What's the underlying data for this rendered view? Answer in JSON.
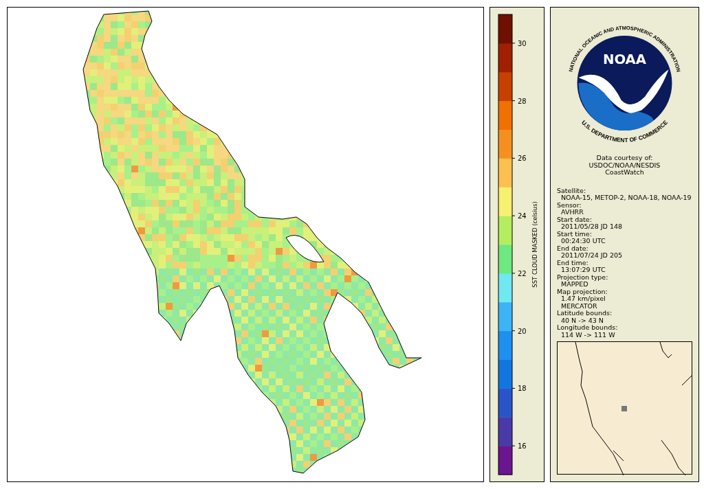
{
  "colorbar": {
    "label": "SST CLOUD MASKED (celsius)",
    "ticks": [
      "30",
      "28",
      "26",
      "24",
      "22",
      "20",
      "18",
      "16"
    ]
  },
  "logo": {
    "wordmark": "NOAA",
    "ring_top": "NATIONAL OCEANIC AND ATMOSPHERIC ADMINISTRATION",
    "ring_bottom": "U.S. DEPARTMENT OF COMMERCE"
  },
  "credits": [
    "Data courtesy of:",
    "USDOC/NOAA/NESDIS",
    "CoastWatch"
  ],
  "fields": [
    {
      "label": "Satellite:",
      "values": [
        "NOAA-15, METOP-2, NOAA-18, NOAA-19"
      ]
    },
    {
      "label": "Sensor:",
      "values": [
        "AVHRR"
      ]
    },
    {
      "label": "Start date:",
      "values": [
        "2011/05/28 JD 148"
      ]
    },
    {
      "label": "Start time:",
      "values": [
        "00:24:30 UTC"
      ]
    },
    {
      "label": "End date:",
      "values": [
        "2011/07/24 JD 205"
      ]
    },
    {
      "label": "End time:",
      "values": [
        "13:07:29 UTC"
      ]
    },
    {
      "label": "Projection type:",
      "values": [
        "MAPPED"
      ]
    },
    {
      "label": "Map projection:",
      "values": [
        "1.47 km/pixel",
        "MERCATOR"
      ]
    },
    {
      "label": "Latitude bounds:",
      "values": [
        "40 N -> 43 N"
      ]
    },
    {
      "label": "Longitude bounds:",
      "values": [
        "114 W -> 111 W"
      ]
    }
  ]
}
